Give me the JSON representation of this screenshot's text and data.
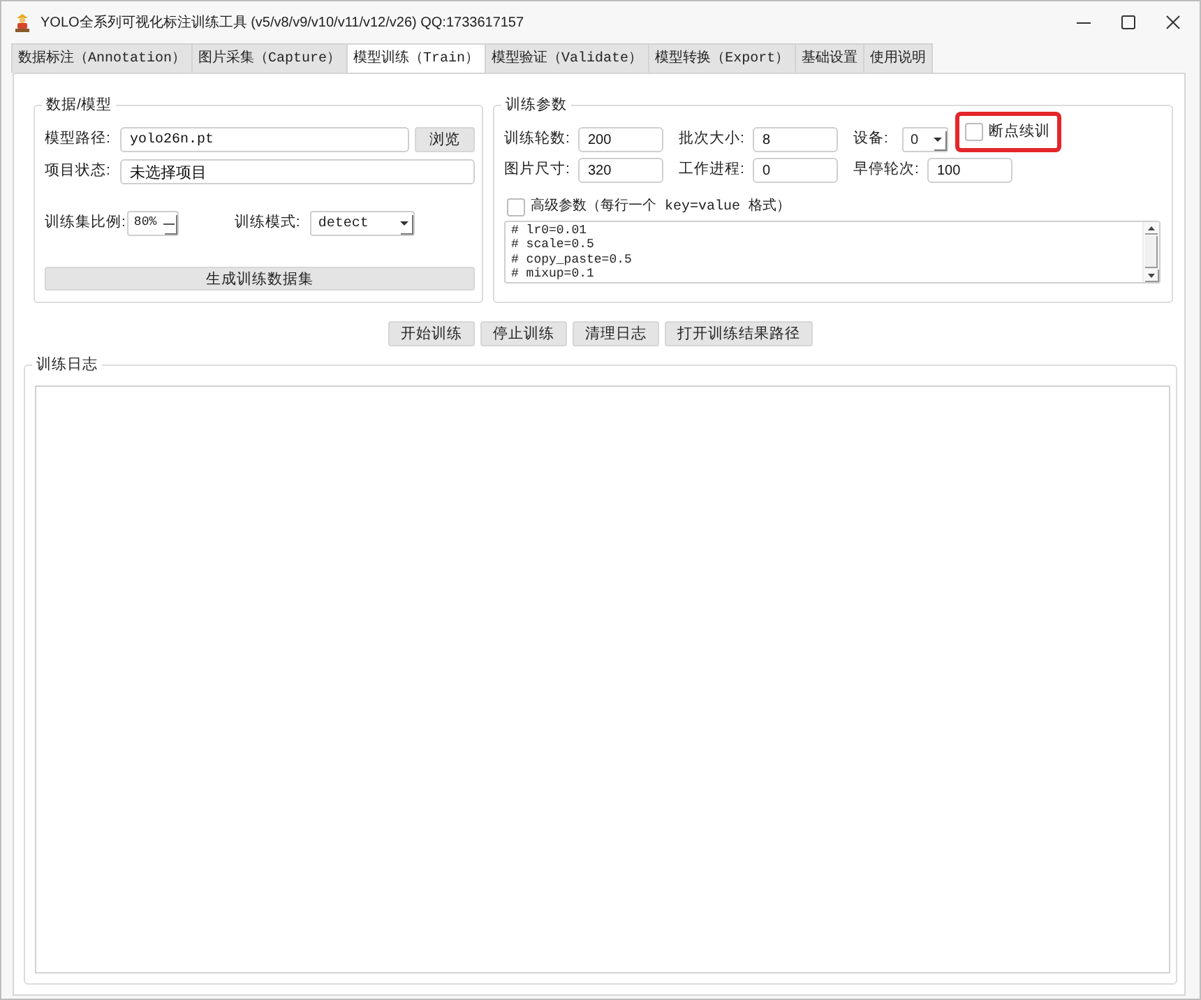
{
  "window": {
    "title": "YOLO全系列可视化标注训练工具 (v5/v8/v9/v10/v11/v12/v26) QQ:1733617157"
  },
  "tabs": [
    {
      "label": "数据标注（Annotation）",
      "selected": false
    },
    {
      "label": "图片采集（Capture）",
      "selected": false
    },
    {
      "label": "模型训练（Train）",
      "selected": true
    },
    {
      "label": "模型验证（Validate）",
      "selected": false
    },
    {
      "label": "模型转换（Export）",
      "selected": false
    },
    {
      "label": "基础设置",
      "selected": false
    },
    {
      "label": "使用说明",
      "selected": false
    }
  ],
  "data_model": {
    "title": "数据/模型",
    "model_path": {
      "label": "模型路径:",
      "value": "yolo26n.pt"
    },
    "browse_button": "浏览",
    "project_status": {
      "label": "项目状态:",
      "value": "未选择项目"
    },
    "train_ratio": {
      "label": "训练集比例:",
      "value": "80%"
    },
    "train_mode": {
      "label": "训练模式:",
      "value": "detect"
    },
    "generate_button": "生成训练数据集"
  },
  "train_params": {
    "title": "训练参数",
    "rows": [
      [
        {
          "kind": "input",
          "label": "训练轮数:",
          "value": "200"
        },
        {
          "kind": "input",
          "label": "批次大小:",
          "value": "8"
        },
        {
          "kind": "combo",
          "label": "设备:",
          "value": "0"
        },
        {
          "kind": "checkbox",
          "label": "断点续训",
          "checked": false,
          "highlighted": true
        }
      ],
      [
        {
          "kind": "input",
          "label": "图片尺寸:",
          "value": "320"
        },
        {
          "kind": "input",
          "label": "工作进程:",
          "value": "0"
        },
        {
          "kind": "input",
          "label": "早停轮次:",
          "value": "100"
        }
      ]
    ],
    "advanced": {
      "label": "高级参数（每行一个 key=value 格式）",
      "checked": false,
      "lines": [
        "# lr0=0.01",
        "# scale=0.5",
        "# copy_paste=0.5",
        "# mixup=0.1"
      ]
    }
  },
  "actions": [
    "开始训练",
    "停止训练",
    "清理日志",
    "打开训练结果路径"
  ],
  "log": {
    "title": "训练日志"
  }
}
